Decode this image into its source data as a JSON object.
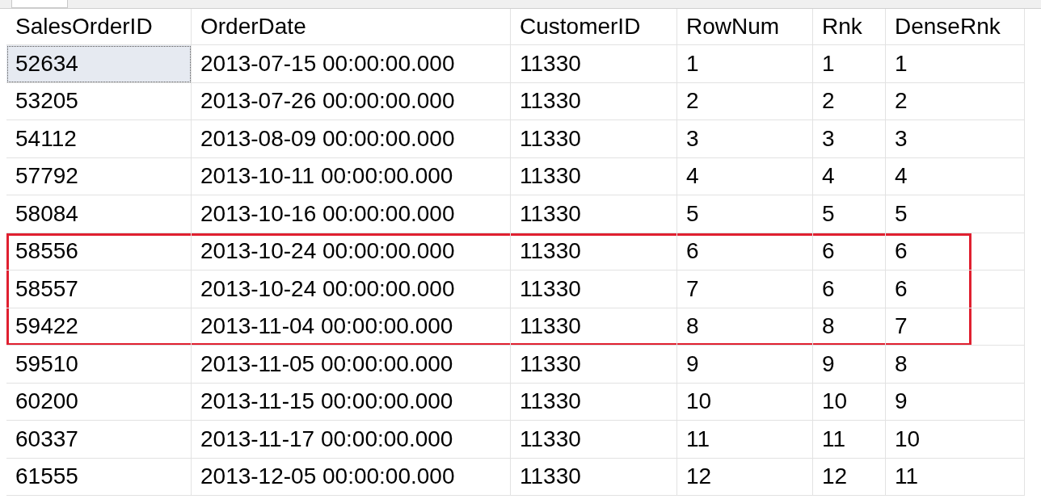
{
  "grid": {
    "columns": [
      "SalesOrderID",
      "OrderDate",
      "CustomerID",
      "RowNum",
      "Rnk",
      "DenseRnk"
    ],
    "rows": [
      {
        "cells": [
          "52634",
          "2013-07-15 00:00:00.000",
          "11330",
          "1",
          "1",
          "1"
        ],
        "focused": true,
        "highlighted": false
      },
      {
        "cells": [
          "53205",
          "2013-07-26 00:00:00.000",
          "11330",
          "2",
          "2",
          "2"
        ],
        "focused": false,
        "highlighted": false
      },
      {
        "cells": [
          "54112",
          "2013-08-09 00:00:00.000",
          "11330",
          "3",
          "3",
          "3"
        ],
        "focused": false,
        "highlighted": false
      },
      {
        "cells": [
          "57792",
          "2013-10-11 00:00:00.000",
          "11330",
          "4",
          "4",
          "4"
        ],
        "focused": false,
        "highlighted": false
      },
      {
        "cells": [
          "58084",
          "2013-10-16 00:00:00.000",
          "11330",
          "5",
          "5",
          "5"
        ],
        "focused": false,
        "highlighted": false
      },
      {
        "cells": [
          "58556",
          "2013-10-24 00:00:00.000",
          "11330",
          "6",
          "6",
          "6"
        ],
        "focused": false,
        "highlighted": true
      },
      {
        "cells": [
          "58557",
          "2013-10-24 00:00:00.000",
          "11330",
          "7",
          "6",
          "6"
        ],
        "focused": false,
        "highlighted": true
      },
      {
        "cells": [
          "59422",
          "2013-11-04 00:00:00.000",
          "11330",
          "8",
          "8",
          "7"
        ],
        "focused": false,
        "highlighted": true
      },
      {
        "cells": [
          "59510",
          "2013-11-05 00:00:00.000",
          "11330",
          "9",
          "9",
          "8"
        ],
        "focused": false,
        "highlighted": false
      },
      {
        "cells": [
          "60200",
          "2013-11-15 00:00:00.000",
          "11330",
          "10",
          "10",
          "9"
        ],
        "focused": false,
        "highlighted": false
      },
      {
        "cells": [
          "60337",
          "2013-11-17 00:00:00.000",
          "11330",
          "11",
          "11",
          "10"
        ],
        "focused": false,
        "highlighted": false
      },
      {
        "cells": [
          "61555",
          "2013-12-05 00:00:00.000",
          "11330",
          "12",
          "12",
          "11"
        ],
        "focused": false,
        "highlighted": false
      }
    ]
  }
}
